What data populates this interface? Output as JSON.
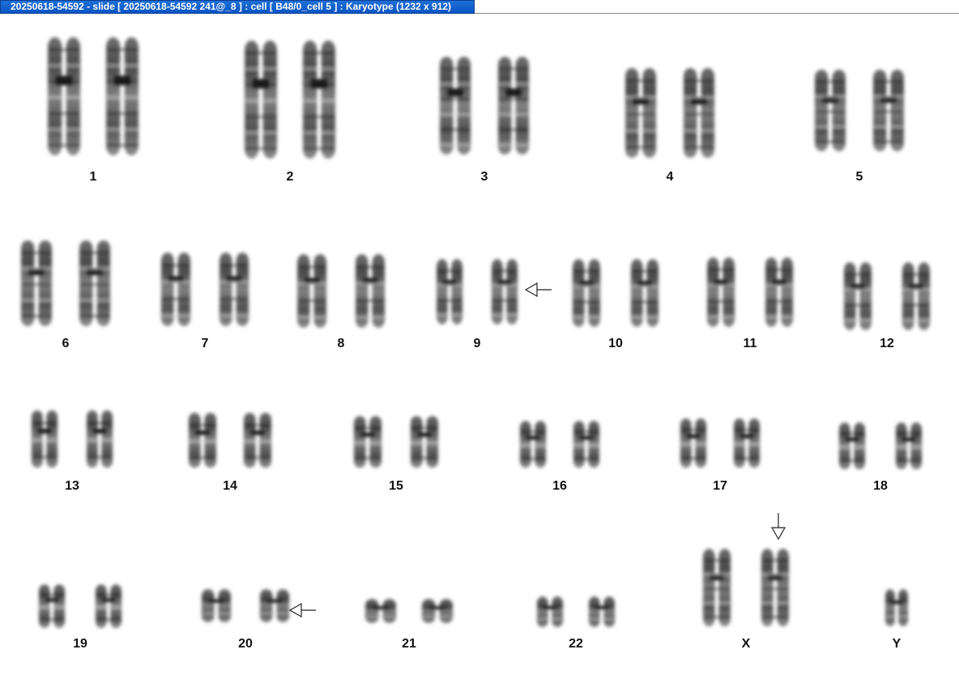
{
  "window": {
    "title": "20250618-54592 - slide [ 20250618-54592 241@_8 ] : cell [ B48/0_cell 5 ] : Karyotype  (1232 x 912)"
  },
  "karyotype": {
    "labels": [
      "1",
      "2",
      "3",
      "4",
      "5",
      "6",
      "7",
      "8",
      "9",
      "10",
      "11",
      "12",
      "13",
      "14",
      "15",
      "16",
      "17",
      "18",
      "19",
      "20",
      "21",
      "22",
      "X",
      "Y"
    ],
    "chromosomes": [
      {
        "label": "1",
        "copies": 2
      },
      {
        "label": "2",
        "copies": 2
      },
      {
        "label": "3",
        "copies": 2
      },
      {
        "label": "4",
        "copies": 2
      },
      {
        "label": "5",
        "copies": 2
      },
      {
        "label": "6",
        "copies": 2
      },
      {
        "label": "7",
        "copies": 2
      },
      {
        "label": "8",
        "copies": 2
      },
      {
        "label": "9",
        "copies": 2,
        "marked": true
      },
      {
        "label": "10",
        "copies": 2
      },
      {
        "label": "11",
        "copies": 2
      },
      {
        "label": "12",
        "copies": 2
      },
      {
        "label": "13",
        "copies": 2
      },
      {
        "label": "14",
        "copies": 2
      },
      {
        "label": "15",
        "copies": 2
      },
      {
        "label": "16",
        "copies": 2
      },
      {
        "label": "17",
        "copies": 2
      },
      {
        "label": "18",
        "copies": 2
      },
      {
        "label": "19",
        "copies": 2
      },
      {
        "label": "20",
        "copies": 2,
        "marked": true
      },
      {
        "label": "21",
        "copies": 2
      },
      {
        "label": "22",
        "copies": 2
      },
      {
        "label": "X",
        "copies": 2,
        "marked": true
      },
      {
        "label": "Y",
        "copies": 1
      }
    ],
    "marker_count": 3
  }
}
